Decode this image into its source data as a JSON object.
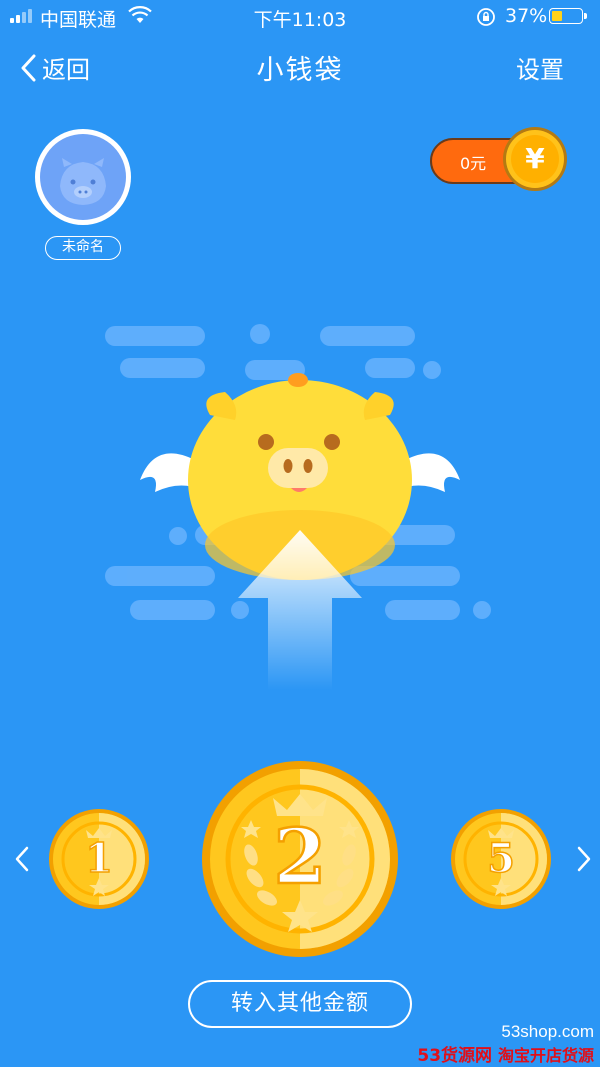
{
  "status_bar": {
    "carrier": "中国联通",
    "time": "下午11:03",
    "battery_percent": "37%",
    "battery_level": 0.37,
    "icons": [
      "signal-icon",
      "wifi-icon",
      "rotation-lock-icon",
      "battery-icon"
    ]
  },
  "nav": {
    "back_label": "返回",
    "title": "小钱袋",
    "settings_label": "设置"
  },
  "profile": {
    "name": "未命名"
  },
  "balance": {
    "amount": "0元",
    "currency_symbol": "¥"
  },
  "coins": {
    "left": "1",
    "center": "2",
    "right": "5",
    "selected": "2"
  },
  "transfer_button": "转入其他金额",
  "watermark": {
    "line1": "53shop.com",
    "line2_brand": "53货源网",
    "line2_rest": "淘宝开店货源"
  },
  "colors": {
    "background": "#2b96f5",
    "coin_gold": "#ffc21a",
    "balance_orange": "#ff6a0e"
  }
}
